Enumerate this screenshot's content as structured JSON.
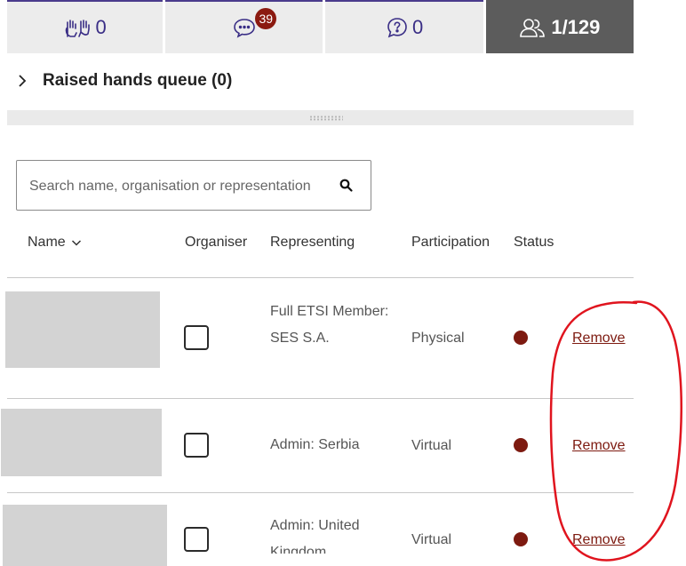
{
  "tabs": [
    {
      "id": "raised-hands",
      "icon": "raised-hands-icon",
      "count": "0"
    },
    {
      "id": "chat",
      "icon": "chat-bubble-icon",
      "badge": "39"
    },
    {
      "id": "questions",
      "icon": "question-bubble-icon",
      "count": "0"
    },
    {
      "id": "participants",
      "icon": "participants-icon",
      "count": "1/129",
      "active": true
    }
  ],
  "raised_hands": {
    "label": "Raised hands queue (0)"
  },
  "search": {
    "placeholder": "Search name, organisation or representation"
  },
  "table": {
    "headers": {
      "name": "Name",
      "organiser": "Organiser",
      "representing": "Representing",
      "participation": "Participation",
      "status": "Status"
    },
    "rows": [
      {
        "representing": "Full ETSI Member: SES S.A.",
        "participation": "Physical",
        "status_color": "#7d1a10",
        "action": "Remove",
        "organiser": false
      },
      {
        "representing": "Admin: Serbia",
        "participation": "Virtual",
        "status_color": "#7d1a10",
        "action": "Remove",
        "organiser": false
      },
      {
        "representing": "Admin: United Kingdom",
        "participation": "Virtual",
        "status_color": "#7d1a10",
        "action": "Remove",
        "organiser": false
      }
    ]
  },
  "colors": {
    "accent": "#3a2e86",
    "status": "#7d1a10",
    "active_tab": "#5c5c5c",
    "annotation": "#e0141e"
  }
}
